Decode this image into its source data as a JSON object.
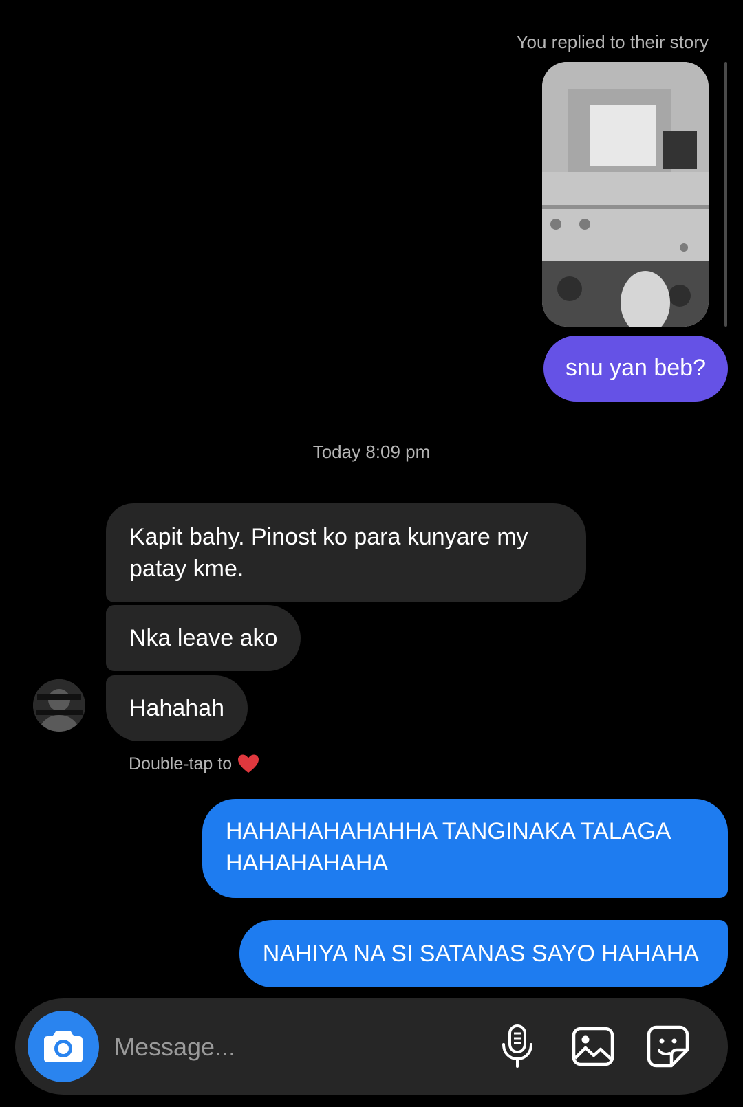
{
  "story_reply": {
    "caption": "You replied to their story"
  },
  "messages": {
    "outgoing_story_reply": "snu yan beb?",
    "timestamp": "Today 8:09 pm",
    "incoming": [
      "Kapit bahy. Pinost ko para kunyare my patay kme.",
      "Nka leave ako",
      "Hahahah"
    ],
    "double_tap_hint": "Double-tap to",
    "outgoing": [
      "HAHAHAHAHAHHA TANGINAKA TALAGA HAHAHAHAHA",
      "NAHIYA NA SI SATANAS SAYO HAHAHA"
    ]
  },
  "composer": {
    "placeholder": "Message..."
  },
  "icons": {
    "camera": "camera-icon",
    "microphone": "microphone-icon",
    "gallery": "gallery-icon",
    "sticker": "sticker-icon",
    "heart": "heart-icon"
  },
  "colors": {
    "background": "#000000",
    "incoming_bubble": "#262626",
    "story_reply_bubble": "#6552e6",
    "outgoing_bubble": "#1e7cf0",
    "camera_button": "#2a84ef",
    "heart": "#e0383e",
    "secondary_text": "#b5b5b5"
  }
}
